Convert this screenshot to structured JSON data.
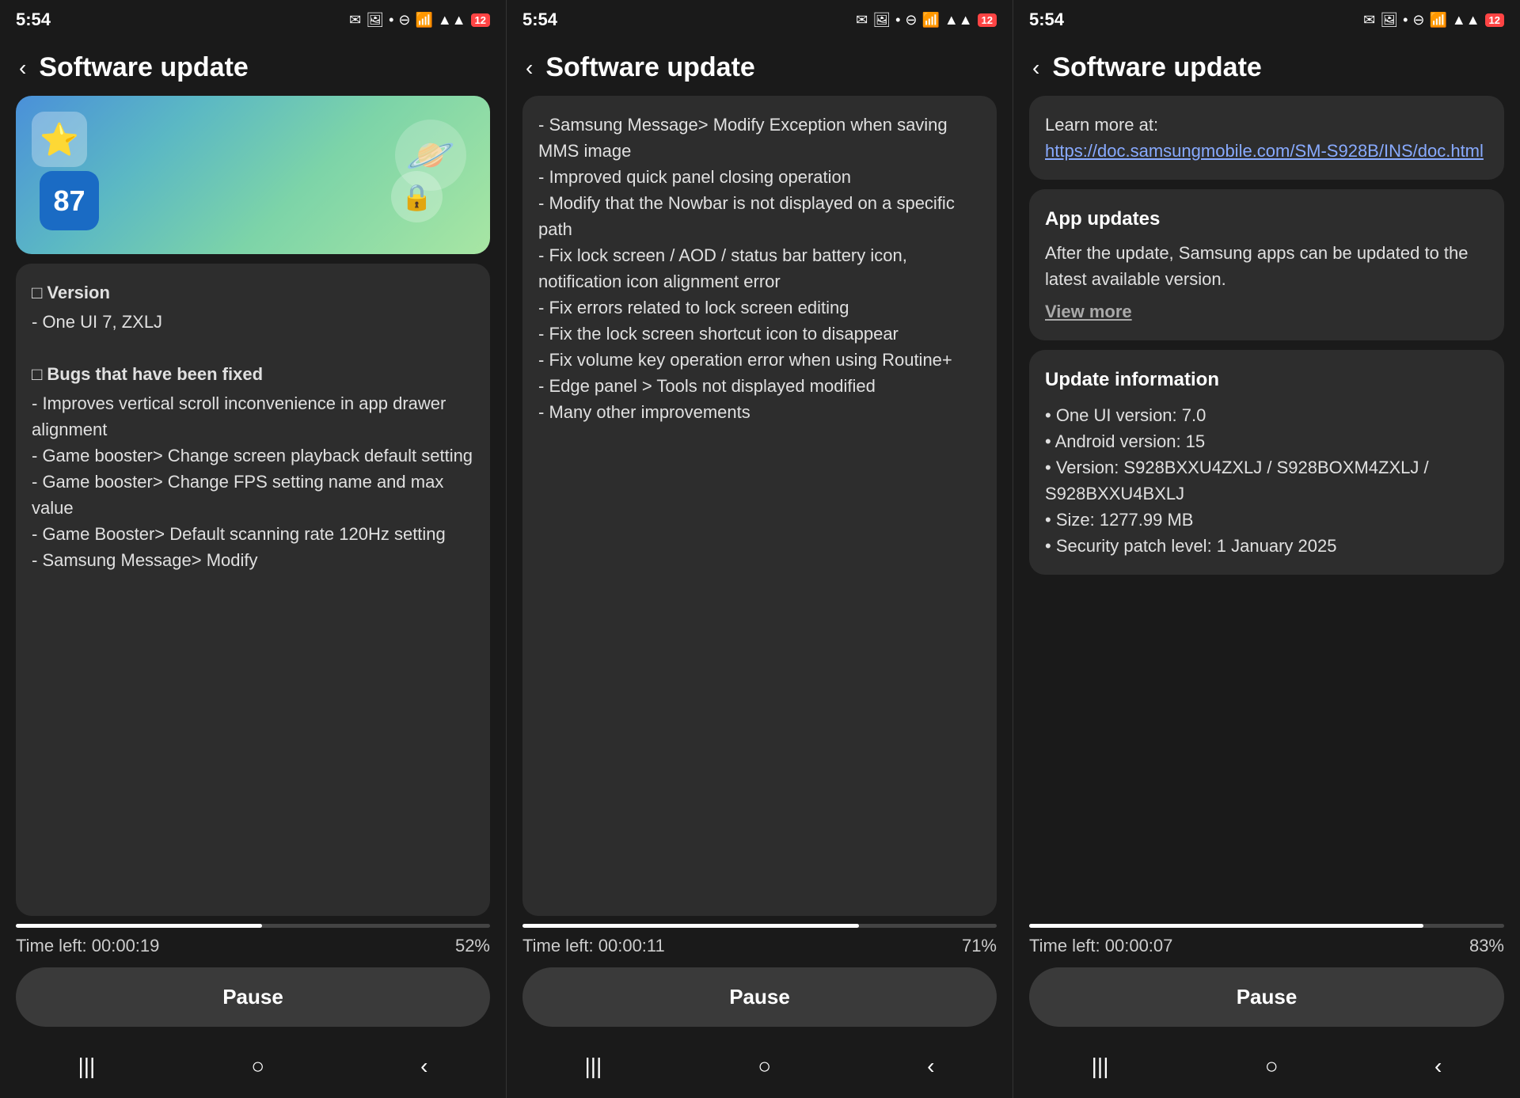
{
  "panels": [
    {
      "id": "panel1",
      "status": {
        "time": "5:54",
        "icons": [
          "✉",
          "📷",
          "•"
        ],
        "battery": "12",
        "signal": "▲▲▲"
      },
      "header": {
        "back_label": "‹",
        "title": "Software update"
      },
      "content": {
        "version_title": "□ Version",
        "version_text": "- One UI 7, ZXLJ",
        "bugs_title": "□ Bugs that have been fixed",
        "bugs_text": "- Improves vertical scroll inconvenience in app drawer alignment\n- Game booster> Change screen playback default setting\n- Game booster> Change FPS setting name and max value\n- Game Booster> Default scanning rate 120Hz setting\n- Samsung Message> Modify"
      },
      "progress": {
        "time_left_label": "Time left: 00:00:19",
        "percent": "52%",
        "fill": 52,
        "pause_label": "Pause"
      },
      "nav": {
        "recent": "|||",
        "home": "○",
        "back": "‹"
      }
    },
    {
      "id": "panel2",
      "status": {
        "time": "5:54",
        "icons": [
          "✉",
          "📷",
          "•"
        ],
        "battery": "12",
        "signal": "▲▲▲"
      },
      "header": {
        "back_label": "‹",
        "title": "Software update"
      },
      "content": {
        "text": "- Samsung Message> Modify Exception when saving MMS image\n- Improved quick panel closing operation\n- Modify that the Nowbar is not displayed on a specific path\n- Fix lock screen / AOD / status bar battery icon, notification icon alignment error\n- Fix errors related to lock screen editing\n- Fix the lock screen shortcut icon to disappear\n- Fix volume key operation error when using Routine+\n- Edge panel > Tools not displayed modified\n- Many other improvements"
      },
      "progress": {
        "time_left_label": "Time left: 00:00:11",
        "percent": "71%",
        "fill": 71,
        "pause_label": "Pause"
      },
      "nav": {
        "recent": "|||",
        "home": "○",
        "back": "‹"
      }
    },
    {
      "id": "panel3",
      "status": {
        "time": "5:54",
        "icons": [
          "✉",
          "📷",
          "•"
        ],
        "battery": "12",
        "signal": "▲▲▲"
      },
      "header": {
        "back_label": "‹",
        "title": "Software update"
      },
      "content": {
        "learn_more_text": "Learn more at:",
        "learn_more_link": "https://doc.samsungmobile.com/SM-S928B/INS/doc.html",
        "app_updates_title": "App updates",
        "app_updates_text": "After the update, Samsung apps can be updated to the latest available version.",
        "view_more_label": "View more",
        "update_info_title": "Update information",
        "update_info_items": [
          "• One UI version: 7.0",
          "• Android version: 15",
          "• Version: S928BXXU4ZXLJ / S928BOXM4ZXLJ / S928BXXU4BXLJ",
          "• Size: 1277.99 MB",
          "• Security patch level: 1 January 2025"
        ]
      },
      "progress": {
        "time_left_label": "Time left: 00:00:07",
        "percent": "83%",
        "fill": 83,
        "pause_label": "Pause"
      },
      "nav": {
        "recent": "|||",
        "home": "○",
        "back": "‹"
      }
    }
  ]
}
